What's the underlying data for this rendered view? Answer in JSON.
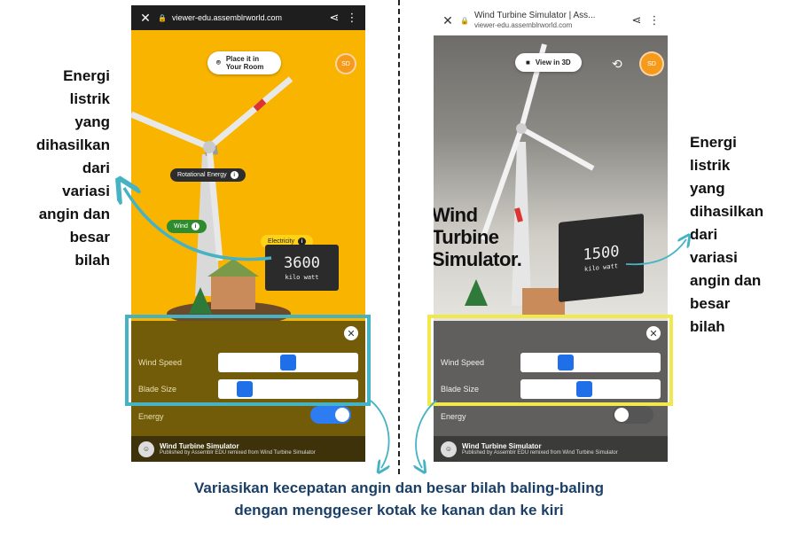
{
  "left_phone": {
    "url": "viewer-edu.assemblrworld.com",
    "place_button": "Place it in Your Room",
    "avatar": "SD",
    "rotational_energy_label": "Rotational Energy",
    "wind_label": "Wind",
    "electricity_label": "Electricity",
    "display_value": "3600",
    "display_unit": "kilo watt",
    "wind_speed_label": "Wind Speed",
    "wind_speed_value": 0.5,
    "blade_size_label": "Blade Size",
    "blade_size_value": 0.15,
    "energy_label": "Energy",
    "energy_on": true,
    "footer_title": "Wind Turbine Simulator",
    "footer_sub": "Published by Assemblr EDU remixed from Wind Turbine Simulator"
  },
  "right_phone": {
    "title": "Wind Turbine Simulator | Ass...",
    "url": "viewer-edu.assemblrworld.com",
    "view_button": "View in 3D",
    "avatar": "SD",
    "big_text": [
      "Wind",
      "Turbine",
      "Simulator."
    ],
    "display_value": "1500",
    "display_unit": "kilo watt",
    "wind_speed_label": "Wind Speed",
    "wind_speed_value": 0.3,
    "blade_size_label": "Blade Size",
    "blade_size_value": 0.45,
    "energy_label": "Energy",
    "energy_on": false,
    "footer_title": "Wind Turbine Simulator",
    "footer_sub": "Published by Assemblr EDU remixed from Wind Turbine Simulator"
  },
  "annotation_left": [
    "Energi",
    "listrik",
    "yang",
    "dihasilkan",
    "dari",
    "variasi",
    "angin dan",
    "besar",
    "bilah"
  ],
  "annotation_right": [
    "Energi",
    "listrik",
    "yang",
    "dihasilkan",
    "dari",
    "variasi",
    "angin dan",
    "besar",
    "bilah"
  ],
  "caption": [
    "Variasikan kecepatan angin dan besar bilah baling-baling",
    "dengan menggeser kotak ke kanan dan ke kiri"
  ],
  "colors": {
    "teal": "#45b3c4",
    "yellow": "#f1e94b",
    "caption": "#1b3f66",
    "slider_thumb": "#1e6fe8",
    "orange_bg": "#f9b400"
  }
}
